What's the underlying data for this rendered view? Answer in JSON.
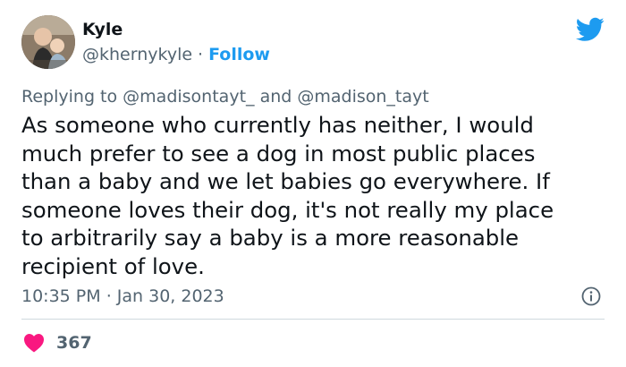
{
  "author": {
    "name": "Kyle",
    "handle": "@khernykyle",
    "separator": "·",
    "follow_label": "Follow"
  },
  "reply": {
    "prefix": "Replying to",
    "mention_1": "@madisontayt_",
    "conjunction": "and",
    "mention_2": "@madison_tayt"
  },
  "tweet": {
    "text": "As someone who currently has neither, I would\nmuch prefer to see a dog in most public places\nthan a baby and we let babies go everywhere. If\nsomeone loves their dog, it's not really my place\nto arbitrarily say a baby is a more reasonable\nrecipient of love.",
    "time": "10:35 PM",
    "date_separator": "·",
    "date": "Jan 30, 2023"
  },
  "stats": {
    "likes": "367"
  },
  "icons": {
    "logo": "twitter-bird-icon",
    "info": "info-icon",
    "like": "heart-icon"
  },
  "colors": {
    "brand": "#1d9bf0",
    "like": "#f91880",
    "text": "#0f1419",
    "muted": "#536471"
  }
}
